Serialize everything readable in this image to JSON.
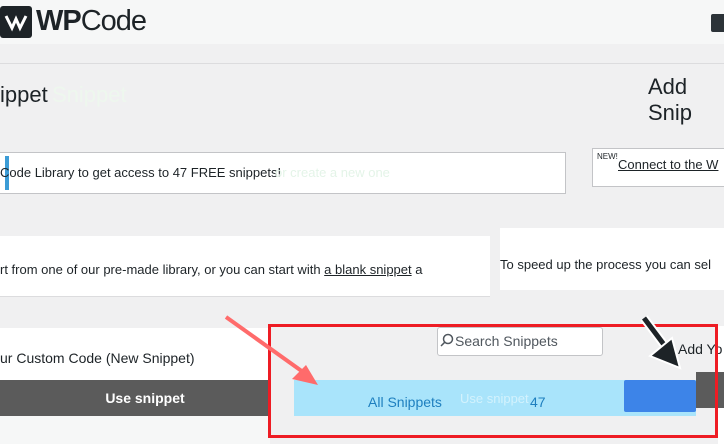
{
  "brand": {
    "name_bold": "WP",
    "name_regular": "Code"
  },
  "page": {
    "title": "ippet",
    "title_ghost": "Snippet",
    "add_snippet_title": "Add Snip"
  },
  "notice": {
    "text": "Code Library to get access to 47 FREE snippets!",
    "ghost_text": "or create a new one",
    "new_badge": "NEW!",
    "connect_link": "Connect to the W"
  },
  "intro": {
    "text_before": "rt from one of our pre-made library, or you can start with ",
    "blank_snippet_link": "a blank snippet",
    "text_after": " a",
    "speed_up_text": "To speed up the process you can sel"
  },
  "card": {
    "title": "ur Custom Code (New Snippet)",
    "use_button_label": "Use snippet",
    "add_label": "Add Yo"
  },
  "library": {
    "search_placeholder": "Search Snippets",
    "all_snippets_label": "All Snippets",
    "all_snippets_count": "47",
    "use_ghost": "Use snippet"
  },
  "colors": {
    "highlight_border": "#ee1c24",
    "accent_blue": "#3d84e8",
    "all_snippets_bg": "#a9e4fb",
    "notice_accent": "#3c9cd6"
  },
  "icons": [
    "logo-icon",
    "help-icon",
    "search-icon",
    "red-arrow-icon",
    "black-arrow-icon"
  ]
}
